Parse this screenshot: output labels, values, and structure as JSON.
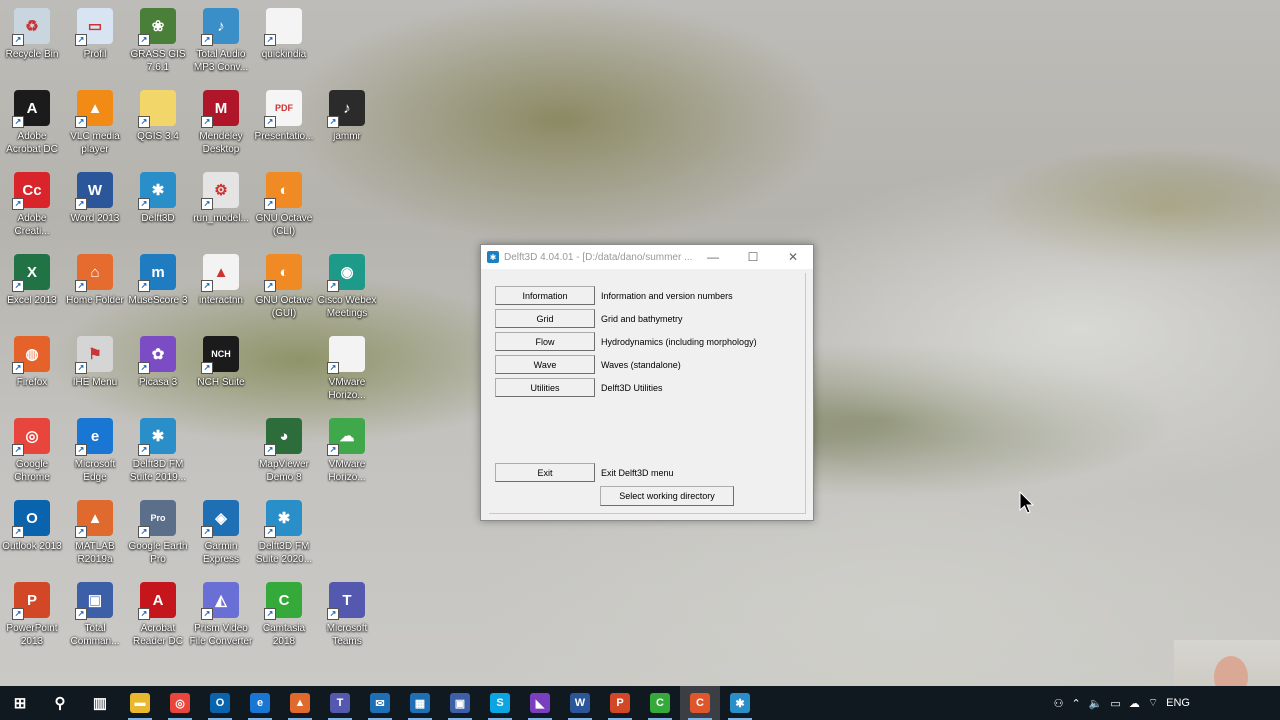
{
  "desktop_icons": [
    {
      "label": "Recycle Bin",
      "name": "recycle-bin-icon",
      "color": "#c9d6e0",
      "sym": "♻"
    },
    {
      "label": "Profil",
      "name": "profil-icon",
      "color": "#d9e4f2",
      "sym": "▭"
    },
    {
      "label": "GRASS GIS 7.6.1",
      "name": "grass-gis-icon",
      "color": "#4a7f3a",
      "sym": "❀"
    },
    {
      "label": "Total Audio MP3 Conv...",
      "name": "total-audio-icon",
      "color": "#3a8fc8",
      "sym": "♪"
    },
    {
      "label": "quickindia",
      "name": "file-icon",
      "color": "#f4f4f4",
      "sym": ""
    },
    {
      "label": "Adobe Acrobat DC",
      "name": "acrobat-icon",
      "color": "#1b1b1b",
      "sym": "A"
    },
    {
      "label": "VLC media player",
      "name": "vlc-icon",
      "color": "#f28a16",
      "sym": "▲"
    },
    {
      "label": "QGIS 3.4",
      "name": "folder-icon",
      "color": "#f2d66a",
      "sym": ""
    },
    {
      "label": "Mendeley Desktop",
      "name": "mendeley-icon",
      "color": "#b0162a",
      "sym": "M"
    },
    {
      "label": "Presentatio...",
      "name": "pdf-file-icon",
      "color": "#f5f5f5",
      "sym": "PDF"
    },
    {
      "label": "jammr",
      "name": "jammr-icon",
      "color": "#2b2b2b",
      "sym": "♪"
    },
    {
      "label": "Adobe Creati...",
      "name": "creative-cloud-icon",
      "color": "#d8242a",
      "sym": "Cc"
    },
    {
      "label": "Word 2013",
      "name": "word-icon",
      "color": "#2b579a",
      "sym": "W"
    },
    {
      "label": "Delft3D",
      "name": "delft3d-icon",
      "color": "#2a8fc9",
      "sym": "✱"
    },
    {
      "label": "run_model...",
      "name": "batch-file-icon",
      "color": "#e4e4e4",
      "sym": "⚙"
    },
    {
      "label": "GNU Octave (CLI)",
      "name": "octave-cli-icon",
      "color": "#f08a24",
      "sym": "◐"
    },
    {
      "label": "Excel 2013",
      "name": "excel-icon",
      "color": "#217346",
      "sym": "X"
    },
    {
      "label": "Home Folder",
      "name": "home-folder-icon",
      "color": "#e66b2e",
      "sym": "⌂"
    },
    {
      "label": "MuseScore 3",
      "name": "musescore-icon",
      "color": "#1f7cc1",
      "sym": "m"
    },
    {
      "label": "interactnn",
      "name": "matlab-file-icon",
      "color": "#f3f3f3",
      "sym": "▲"
    },
    {
      "label": "GNU Octave (GUI)",
      "name": "octave-gui-icon",
      "color": "#f08a24",
      "sym": "◐"
    },
    {
      "label": "Cisco Webex Meetings",
      "name": "webex-icon",
      "color": "#1d9a8a",
      "sym": "◉"
    },
    {
      "label": "Firefox",
      "name": "firefox-icon",
      "color": "#e5632b",
      "sym": "◍"
    },
    {
      "label": "IHE Menu",
      "name": "ihe-menu-icon",
      "color": "#d5d5d5",
      "sym": "⚑"
    },
    {
      "label": "Picasa 3",
      "name": "picasa-icon",
      "color": "#7c4cc4",
      "sym": "✿"
    },
    {
      "label": "NCH Suite",
      "name": "nch-suite-icon",
      "color": "#1b1b1b",
      "sym": "NCH"
    },
    {
      "label": "VMware Horizo...",
      "name": "vmware-file-icon",
      "color": "#f3f3f3",
      "sym": ""
    },
    {
      "label": "Google Chrome",
      "name": "chrome-icon",
      "color": "#e8453c",
      "sym": "◎"
    },
    {
      "label": "Microsoft Edge",
      "name": "edge-icon",
      "color": "#1976d2",
      "sym": "e"
    },
    {
      "label": "Delft3D FM Suite 2019...",
      "name": "delft3d-fm-icon",
      "color": "#2a8fc9",
      "sym": "✱"
    },
    {
      "label": "MapViewer Demo 8",
      "name": "mapviewer-icon",
      "color": "#2d6c3b",
      "sym": "◕"
    },
    {
      "label": "VMware Horizo...",
      "name": "vmware-horizon-icon",
      "color": "#3ea84a",
      "sym": "☁"
    },
    {
      "label": "Outlook 2013",
      "name": "outlook-icon",
      "color": "#0a64ad",
      "sym": "O"
    },
    {
      "label": "MATLAB R2019a",
      "name": "matlab-icon",
      "color": "#e0692d",
      "sym": "▲"
    },
    {
      "label": "Google Earth Pro",
      "name": "google-earth-icon",
      "color": "#5b6f8a",
      "sym": "Pro"
    },
    {
      "label": "Garmin Express",
      "name": "garmin-icon",
      "color": "#1f6fb5",
      "sym": "◈"
    },
    {
      "label": "Delft3D FM Suite 2020...",
      "name": "delft3d-fm-2020-icon",
      "color": "#2a8fc9",
      "sym": "✱"
    },
    {
      "label": "PowerPoint 2013",
      "name": "powerpoint-icon",
      "color": "#d24726",
      "sym": "P"
    },
    {
      "label": "Total Comman...",
      "name": "total-commander-icon",
      "color": "#3d5fa8",
      "sym": "▣"
    },
    {
      "label": "Acrobat Reader DC",
      "name": "acrobat-reader-icon",
      "color": "#c4161c",
      "sym": "A"
    },
    {
      "label": "Prism Video File Converter",
      "name": "prism-icon",
      "color": "#6a6fd6",
      "sym": "◭"
    },
    {
      "label": "Camtasia 2018",
      "name": "camtasia-icon",
      "color": "#35a93a",
      "sym": "C"
    },
    {
      "label": "Microsoft Teams",
      "name": "teams-icon",
      "color": "#5558af",
      "sym": "T"
    }
  ],
  "dialog": {
    "title": "Delft3D 4.04.01 - [D:/data/dano/summer ...",
    "buttons": [
      {
        "label": "Information",
        "desc": "Information and version numbers"
      },
      {
        "label": "Grid",
        "desc": "Grid and bathymetry"
      },
      {
        "label": "Flow",
        "desc": "Hydrodynamics (including morphology)"
      },
      {
        "label": "Wave",
        "desc": "Waves (standalone)"
      },
      {
        "label": "Utilities",
        "desc": "Delft3D Utilities"
      }
    ],
    "exit_label": "Exit",
    "exit_desc": "Exit Delft3D menu",
    "workdir_label": "Select working directory",
    "minimize": "—",
    "maximize": "☐",
    "close": "✕"
  },
  "taskbar": {
    "items": [
      {
        "name": "start-button",
        "sym": "⊞",
        "color": "transparent",
        "active": false
      },
      {
        "name": "search-icon",
        "sym": "⚲",
        "color": "transparent",
        "active": false
      },
      {
        "name": "task-view-icon",
        "sym": "▥",
        "color": "transparent",
        "active": false
      },
      {
        "name": "file-explorer-icon",
        "sym": "▬",
        "color": "#e8b92f",
        "active": false
      },
      {
        "name": "chrome-icon",
        "sym": "◎",
        "color": "#e8453c",
        "active": false
      },
      {
        "name": "outlook-icon",
        "sym": "O",
        "color": "#0a64ad",
        "active": false
      },
      {
        "name": "edge-icon",
        "sym": "e",
        "color": "#1976d2",
        "active": false
      },
      {
        "name": "matlab-icon",
        "sym": "▲",
        "color": "#e0692d",
        "active": false
      },
      {
        "name": "teams-icon",
        "sym": "T",
        "color": "#5558af",
        "active": false
      },
      {
        "name": "mail-icon",
        "sym": "✉",
        "color": "#1f6fb5",
        "active": false
      },
      {
        "name": "calendar-icon",
        "sym": "▦",
        "color": "#1f6fb5",
        "active": false
      },
      {
        "name": "total-commander-icon",
        "sym": "▣",
        "color": "#3d5fa8",
        "active": false
      },
      {
        "name": "skype-icon",
        "sym": "S",
        "color": "#0ba5e3",
        "active": false
      },
      {
        "name": "visual-studio-icon",
        "sym": "◣",
        "color": "#7a3fbf",
        "active": false
      },
      {
        "name": "word-icon",
        "sym": "W",
        "color": "#2b579a",
        "active": false
      },
      {
        "name": "powerpoint-icon",
        "sym": "P",
        "color": "#d24726",
        "active": false
      },
      {
        "name": "camtasia-icon",
        "sym": "C",
        "color": "#35a93a",
        "active": false
      },
      {
        "name": "camtasia-recorder-icon",
        "sym": "C",
        "color": "#e0562c",
        "active": true
      },
      {
        "name": "delft3d-icon",
        "sym": "✱",
        "color": "#2a8fc9",
        "active": false
      }
    ],
    "tray": {
      "lang": "ENG"
    }
  }
}
